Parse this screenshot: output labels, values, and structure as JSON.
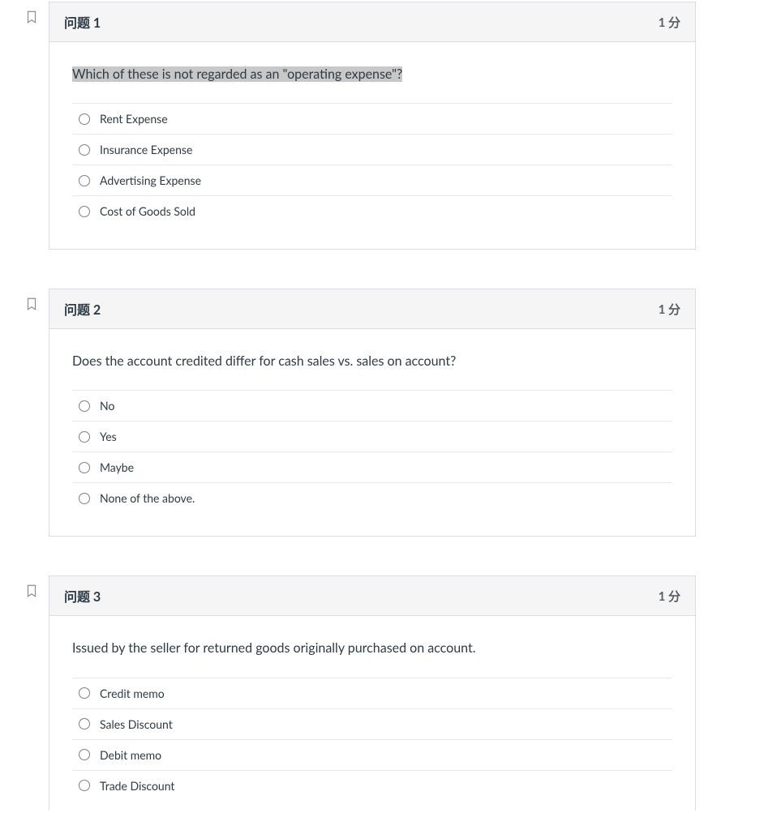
{
  "questions": [
    {
      "title": "问题 1",
      "points_label": "1 分",
      "prompt": "Which of these is not regarded as an \"operating expense\"?",
      "highlighted": true,
      "answers": [
        {
          "label": "Rent Expense"
        },
        {
          "label": "Insurance Expense"
        },
        {
          "label": "Advertising Expense"
        },
        {
          "label": "Cost of Goods Sold"
        }
      ]
    },
    {
      "title": "问题 2",
      "points_label": "1 分",
      "prompt": "Does the account credited differ for cash sales vs. sales on account?",
      "highlighted": false,
      "answers": [
        {
          "label": "No"
        },
        {
          "label": "Yes"
        },
        {
          "label": "Maybe"
        },
        {
          "label": "None of the above."
        }
      ]
    },
    {
      "title": "问题 3",
      "points_label": "1 分",
      "prompt": "Issued by the seller for returned goods originally purchased on account.",
      "highlighted": false,
      "answers": [
        {
          "label": "Credit memo"
        },
        {
          "label": "Sales Discount"
        },
        {
          "label": "Debit memo"
        },
        {
          "label": "Trade Discount"
        }
      ]
    }
  ]
}
